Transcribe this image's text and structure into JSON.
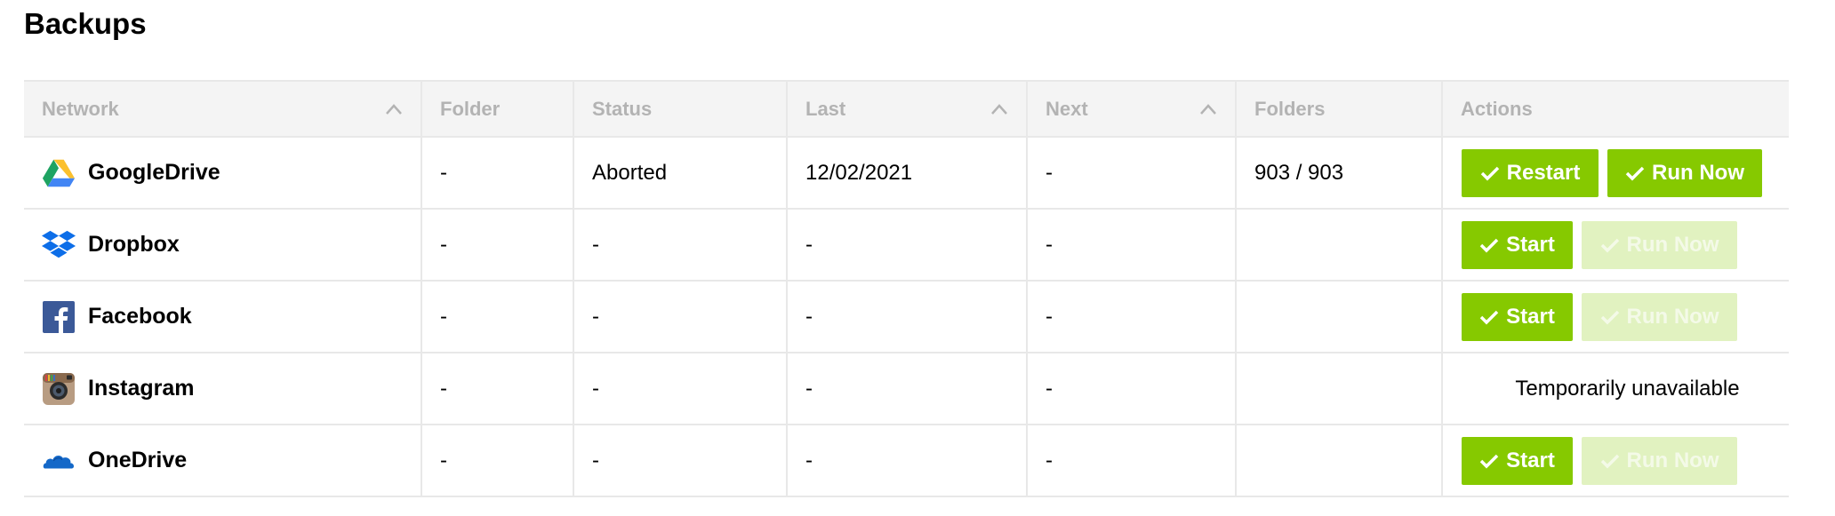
{
  "page": {
    "title": "Backups"
  },
  "columns": [
    {
      "label": "Network",
      "sortable": true
    },
    {
      "label": "Folder",
      "sortable": false
    },
    {
      "label": "Status",
      "sortable": false
    },
    {
      "label": "Last",
      "sortable": true
    },
    {
      "label": "Next",
      "sortable": true
    },
    {
      "label": "Folders",
      "sortable": false
    },
    {
      "label": "Actions",
      "sortable": false
    }
  ],
  "rows": [
    {
      "network": "GoogleDrive",
      "icon": "google-drive-icon",
      "folder": "-",
      "status": "Aborted",
      "last": "12/02/2021",
      "next": "-",
      "folders": "903 / 903",
      "actions": {
        "primary": "Restart",
        "secondary": "Run Now",
        "secondary_enabled": true
      }
    },
    {
      "network": "Dropbox",
      "icon": "dropbox-icon",
      "folder": "-",
      "status": "-",
      "last": "-",
      "next": "-",
      "folders": "",
      "actions": {
        "primary": "Start",
        "secondary": "Run Now",
        "secondary_enabled": false
      }
    },
    {
      "network": "Facebook",
      "icon": "facebook-icon",
      "folder": "-",
      "status": "-",
      "last": "-",
      "next": "-",
      "folders": "",
      "actions": {
        "primary": "Start",
        "secondary": "Run Now",
        "secondary_enabled": false
      }
    },
    {
      "network": "Instagram",
      "icon": "instagram-icon",
      "folder": "-",
      "status": "-",
      "last": "-",
      "next": "-",
      "folders": "",
      "actions": {
        "unavailable_text": "Temporarily unavailable"
      }
    },
    {
      "network": "OneDrive",
      "icon": "onedrive-icon",
      "folder": "-",
      "status": "-",
      "last": "-",
      "next": "-",
      "folders": "",
      "actions": {
        "primary": "Start",
        "secondary": "Run Now",
        "secondary_enabled": false
      }
    }
  ],
  "colors": {
    "accent": "#86c900",
    "accent_disabled": "#e1f2c0",
    "header_bg": "#f4f4f4",
    "header_text": "#b3b3b3",
    "border": "#e8e8e8"
  }
}
